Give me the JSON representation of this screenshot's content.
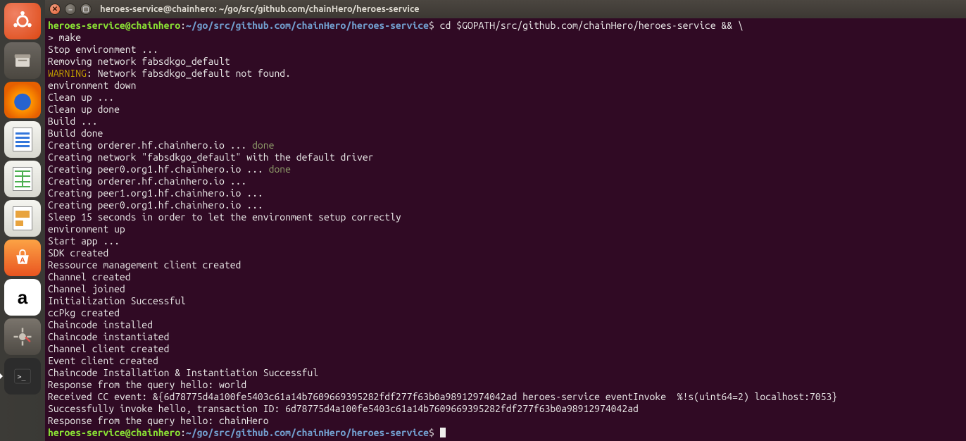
{
  "window": {
    "title": "heroes-service@chainhero: ~/go/src/github.com/chainHero/heroes-service"
  },
  "launcher": {
    "items": [
      {
        "name": "ubuntu-dash",
        "glyph": ""
      },
      {
        "name": "files",
        "glyph": ""
      },
      {
        "name": "firefox",
        "glyph": ""
      },
      {
        "name": "libreoffice-writer",
        "glyph": ""
      },
      {
        "name": "libreoffice-calc",
        "glyph": ""
      },
      {
        "name": "libreoffice-impress",
        "glyph": ""
      },
      {
        "name": "ubuntu-software",
        "glyph": ""
      },
      {
        "name": "amazon",
        "glyph": "a"
      },
      {
        "name": "system-settings",
        "glyph": ""
      },
      {
        "name": "terminal",
        "glyph": ">_"
      }
    ]
  },
  "prompt": {
    "user_host": "heroes-service@chainhero",
    "colon": ":",
    "path": "~/go/src/github.com/chainHero/heroes-service",
    "dollar": "$",
    "cmd1": " cd $GOPATH/src/github.com/chainHero/heroes-service && \\",
    "cmd2": "> make"
  },
  "output": {
    "l01": "Stop environment ...",
    "l02": "Removing network fabsdkgo_default",
    "l03a": "WARNING",
    "l03b": ": Network fabsdkgo_default not found.",
    "l04": "environment down",
    "l05": "Clean up ...",
    "l06": "Clean up done",
    "l07": "Build ...",
    "l08": "Build done",
    "l09a": "Creating orderer.hf.chainhero.io ... ",
    "l09b": "done",
    "l10": "Creating network \"fabsdkgo_default\" with the default driver",
    "l11a": "Creating peer0.org1.hf.chainhero.io ... ",
    "l11b": "done",
    "l12": "Creating orderer.hf.chainhero.io ...",
    "l13": "Creating peer1.org1.hf.chainhero.io ...",
    "l14": "Creating peer0.org1.hf.chainhero.io ...",
    "l15": "Sleep 15 seconds in order to let the environment setup correctly",
    "l16": "environment up",
    "l17": "Start app ...",
    "l18": "SDK created",
    "l19": "Ressource management client created",
    "l20": "Channel created",
    "l21": "Channel joined",
    "l22": "Initialization Successful",
    "l23": "ccPkg created",
    "l24": "Chaincode installed",
    "l25": "Chaincode instantiated",
    "l26": "Channel client created",
    "l27": "Event client created",
    "l28": "Chaincode Installation & Instantiation Successful",
    "l29": "Response from the query hello: world",
    "l30": "Received CC event: &{6d78775d4a100fe5403c61a14b7609669395282fdf277f63b0a98912974042ad heroes-service eventInvoke  %!s(uint64=2) localhost:7053}",
    "l31": "Successfully invoke hello, transaction ID: 6d78775d4a100fe5403c61a14b7609669395282fdf277f63b0a98912974042ad",
    "l32": "Response from the query hello: chainHero"
  },
  "prompt2": {
    "user_host": "heroes-service@chainhero",
    "colon": ":",
    "path": "~/go/src/github.com/chainHero/heroes-service",
    "dollar": "$ "
  }
}
